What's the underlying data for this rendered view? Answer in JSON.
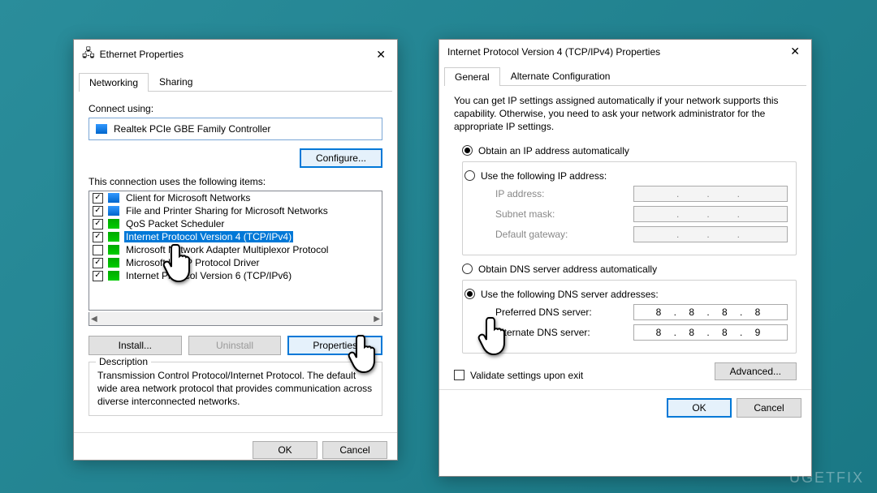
{
  "watermark": "UGETFIX",
  "left": {
    "title": "Ethernet Properties",
    "tabs": {
      "networking": "Networking",
      "sharing": "Sharing"
    },
    "connect_using_label": "Connect using:",
    "adapter": "Realtek PCIe GBE Family Controller",
    "configure_btn": "Configure...",
    "items_label": "This connection uses the following items:",
    "items": [
      {
        "checked": true,
        "label": "Client for Microsoft Networks"
      },
      {
        "checked": true,
        "label": "File and Printer Sharing for Microsoft Networks"
      },
      {
        "checked": true,
        "label": "QoS Packet Scheduler"
      },
      {
        "checked": true,
        "label": "Internet Protocol Version 4 (TCP/IPv4)"
      },
      {
        "checked": false,
        "label": "Microsoft Network Adapter Multiplexor Protocol"
      },
      {
        "checked": true,
        "label": "Microsoft LLDP Protocol Driver"
      },
      {
        "checked": true,
        "label": "Internet Protocol Version 6 (TCP/IPv6)"
      }
    ],
    "install_btn": "Install...",
    "uninstall_btn": "Uninstall",
    "properties_btn": "Properties",
    "description_heading": "Description",
    "description_text": "Transmission Control Protocol/Internet Protocol. The default wide area network protocol that provides communication across diverse interconnected networks.",
    "ok": "OK",
    "cancel": "Cancel"
  },
  "right": {
    "title": "Internet Protocol Version 4 (TCP/IPv4) Properties",
    "tabs": {
      "general": "General",
      "alt": "Alternate Configuration"
    },
    "intro": "You can get IP settings assigned automatically if your network supports this capability. Otherwise, you need to ask your network administrator for the appropriate IP settings.",
    "ip_auto": "Obtain an IP address automatically",
    "ip_manual": "Use the following IP address:",
    "ip_fields": {
      "ip": "IP address:",
      "subnet": "Subnet mask:",
      "gateway": "Default gateway:"
    },
    "dns_auto": "Obtain DNS server address automatically",
    "dns_manual": "Use the following DNS server addresses:",
    "dns_fields": {
      "preferred": "Preferred DNS server:",
      "alternate": "Alternate DNS server:",
      "preferred_val": "8 . 8 . 8 . 8",
      "alternate_val": "8 . 8 . 8 . 9"
    },
    "validate": "Validate settings upon exit",
    "advanced_btn": "Advanced...",
    "ok": "OK",
    "cancel": "Cancel"
  }
}
